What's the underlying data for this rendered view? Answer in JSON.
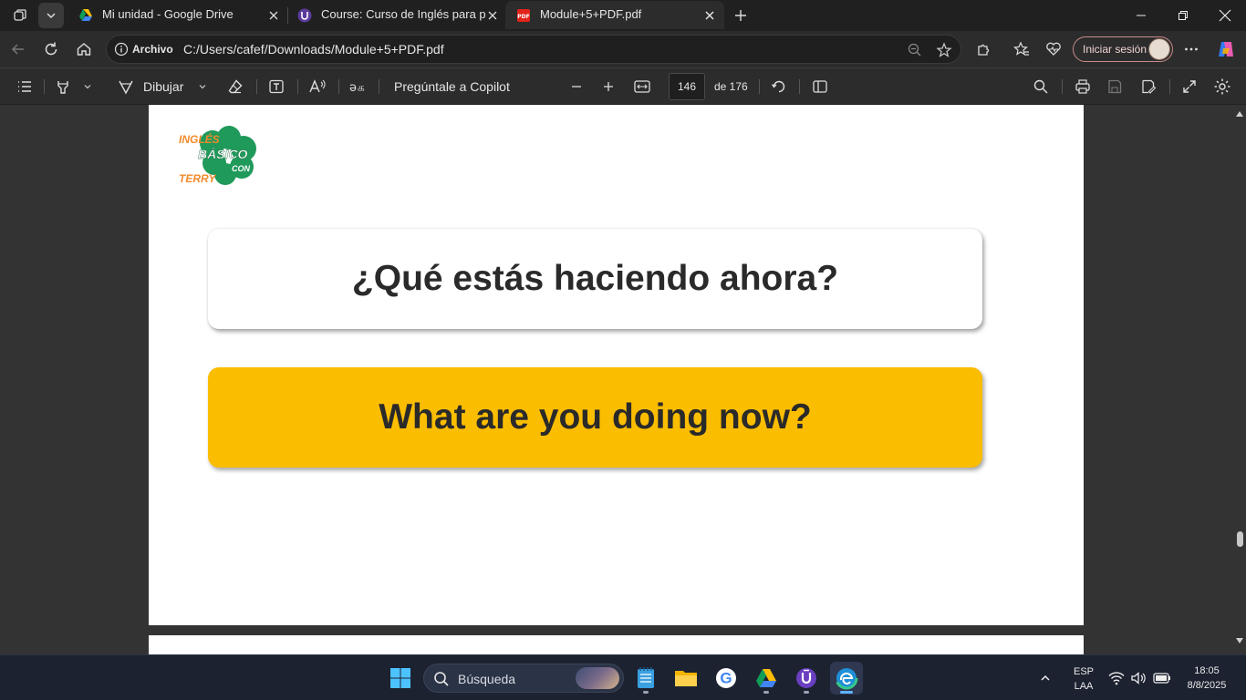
{
  "browser": {
    "tabs": [
      {
        "title": "Mi unidad - Google Drive",
        "favicon": "google-drive-icon"
      },
      {
        "title": "Course: Curso de Inglés para principiantes",
        "favicon": "course-shield-icon"
      },
      {
        "title": "Module+5+PDF.pdf",
        "favicon": "pdf-icon",
        "active": true
      }
    ],
    "address": {
      "scheme_label": "Archivo",
      "url": "C:/Users/cafef/Downloads/Module+5+PDF.pdf"
    },
    "signin_label": "Iniciar sesión"
  },
  "pdf_toolbar": {
    "draw_label": "Dibujar",
    "copilot_label": "Pregúntale a Copilot",
    "current_page": "146",
    "total_pages_label": "de 176"
  },
  "document": {
    "logo": {
      "line1": "INGLÉS",
      "line2": "BÁSICO",
      "line3": "CON",
      "line4": "TERRY"
    },
    "question_es": "¿Qué estás haciendo ahora?",
    "question_en": "What are you doing now?"
  },
  "taskbar": {
    "search_label": "Búsqueda",
    "language": "ESP",
    "region": "LAA",
    "time": "18:05",
    "date": "8/8/2025"
  },
  "colors": {
    "accent_yellow": "#fbbd00",
    "logo_green": "#1f9a5a",
    "logo_orange": "#f28a2b"
  }
}
